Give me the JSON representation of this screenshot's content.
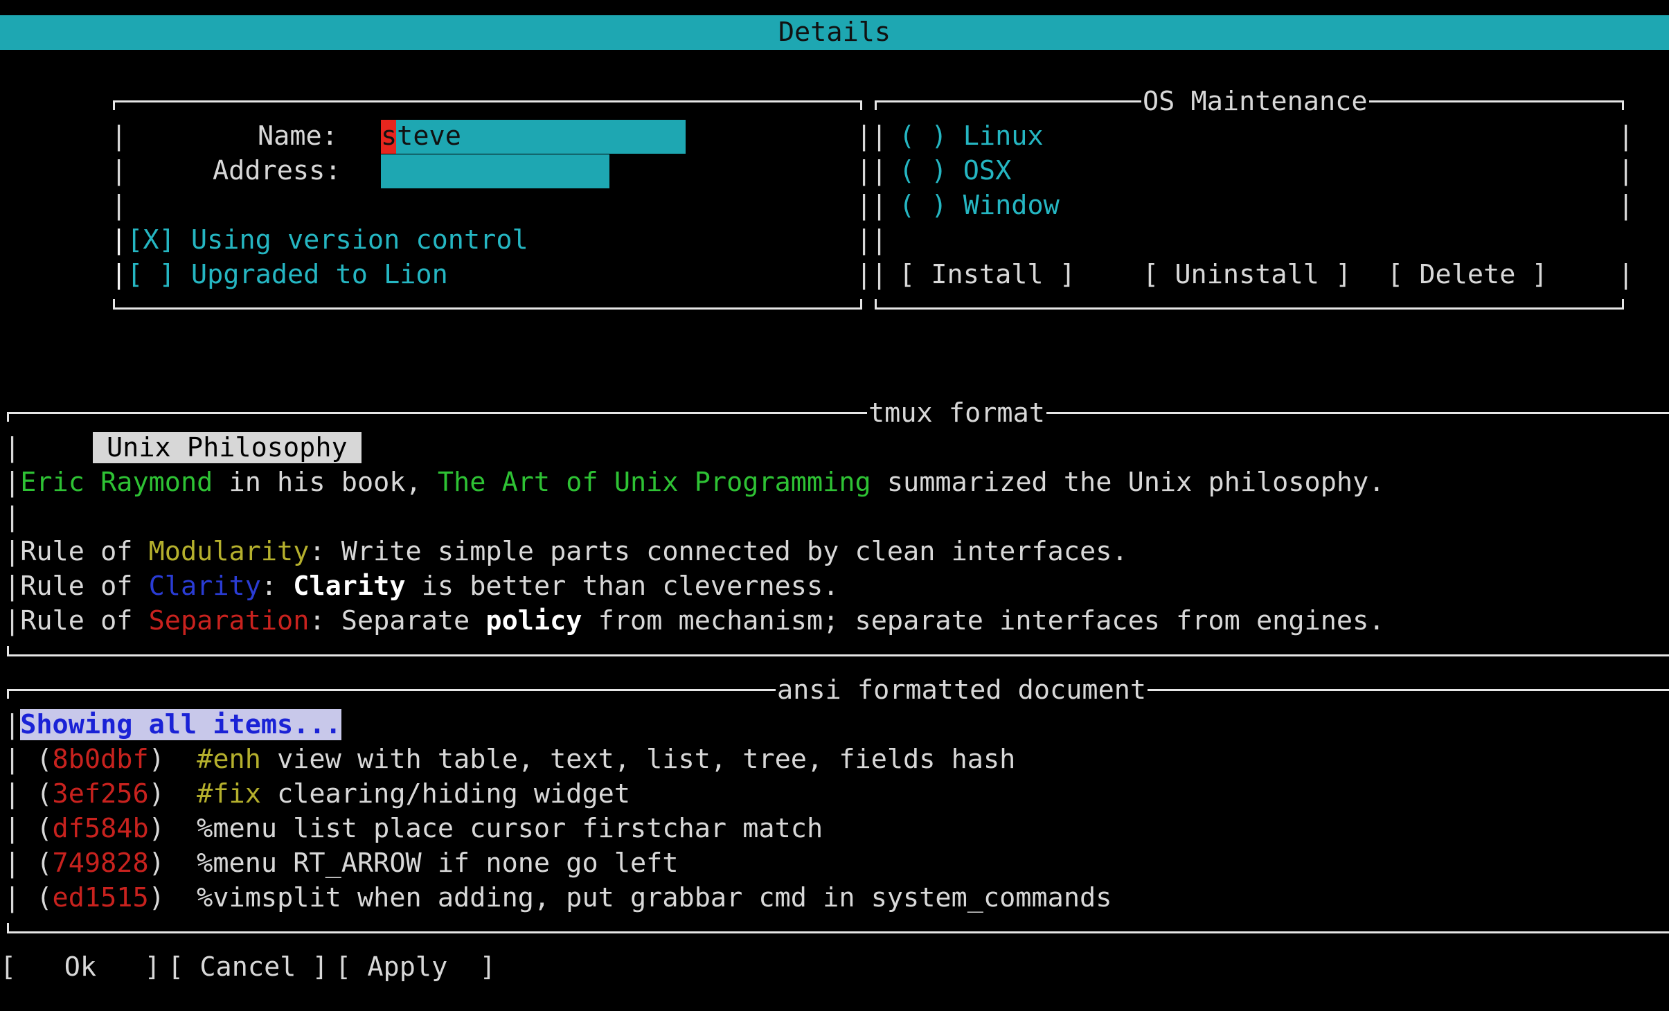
{
  "window": {
    "title": "Details"
  },
  "details_form": {
    "name_label": "Name:",
    "name_value": "steve",
    "address_label": "Address:",
    "address_value": "",
    "checkbox_vc_mark": "[X]",
    "checkbox_vc_label": "Using version control",
    "checkbox_lion_mark": "[ ]",
    "checkbox_lion_label": "Upgraded to Lion"
  },
  "os_maintenance": {
    "title": "OS Maintenance",
    "radio_mark": "( )",
    "options": [
      "Linux",
      "OSX",
      "Window"
    ],
    "install_label": "[ Install ]",
    "uninstall_label": "[ Uninstall ]",
    "delete_label": "[ Delete ]"
  },
  "tmux_section": {
    "title": "tmux format",
    "heading": "Unix Philosophy",
    "line1": {
      "author": "Eric Raymond",
      "mid": " in his book, ",
      "book": "The Art of Unix Programming",
      "end": " summarized the Unix philosophy."
    },
    "rules": [
      {
        "prefix": "Rule of ",
        "term": "Modularity",
        "colon": ": ",
        "text": "Write simple parts connected by clean interfaces."
      },
      {
        "prefix": "Rule of ",
        "term": "Clarity",
        "colon": ": ",
        "bold": "Clarity",
        "text": " is better than cleverness."
      },
      {
        "prefix": "Rule of ",
        "term": "Separation",
        "colon": ": ",
        "text_a": "Separate ",
        "bold": "policy",
        "text_b": " from mechanism; separate interfaces from engines."
      }
    ]
  },
  "ansi_section": {
    "title": "ansi formatted document",
    "status": "Showing all items...",
    "commits": [
      {
        "hash": "8b0dbf",
        "tag": "#enh",
        "message": " view with table, text, list, tree, fields hash"
      },
      {
        "hash": "3ef256",
        "tag": "#fix",
        "message": " clearing/hiding widget"
      },
      {
        "hash": "df584b",
        "tag": "",
        "message": "%menu list place cursor firstchar match"
      },
      {
        "hash": "749828",
        "tag": "",
        "message": "%menu RT_ARROW if none go left"
      },
      {
        "hash": "ed1515",
        "tag": "",
        "message": "%vimsplit when adding, put grabbar cmd in system_commands"
      }
    ]
  },
  "footer": {
    "ok_label": "[   Ok   ]",
    "cancel_label": "[ Cancel ]",
    "apply_label": "[ Apply  ]"
  }
}
